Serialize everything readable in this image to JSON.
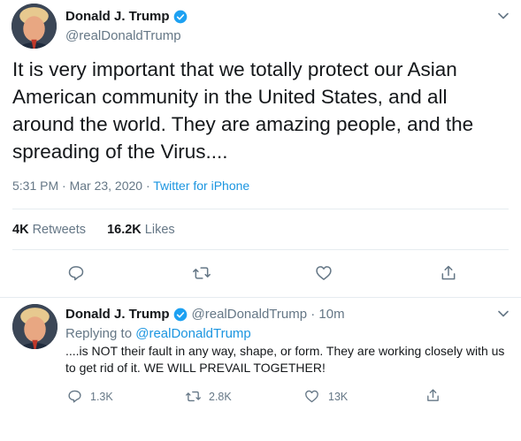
{
  "main_tweet": {
    "display_name": "Donald J. Trump",
    "handle": "@realDonaldTrump",
    "text": "It is very important that we totally protect our Asian American community in the United States, and all around the world. They are amazing people, and the spreading of the Virus....",
    "time": "5:31 PM · Mar 23, 2020 · ",
    "source": "Twitter for iPhone",
    "retweets_count": "4K",
    "retweets_label": "Retweets",
    "likes_count": "16.2K",
    "likes_label": "Likes"
  },
  "reply_tweet": {
    "display_name": "Donald J. Trump",
    "handle_time": "@realDonaldTrump · 10m",
    "replying_prefix": "Replying to ",
    "replying_mention": "@realDonaldTrump",
    "text": "....is NOT their fault in any way, shape, or form. They are working closely with us to get rid of it. WE WILL PREVAIL TOGETHER!",
    "reply_count": "1.3K",
    "retweet_count": "2.8K",
    "like_count": "13K"
  },
  "colors": {
    "text_primary": "#14171a",
    "text_secondary": "#657786",
    "link": "#1b95e0",
    "verified": "#1da1f2",
    "divider": "#e6ecf0"
  },
  "icons": [
    "verified-badge-icon",
    "chevron-down-icon",
    "reply-icon",
    "retweet-icon",
    "like-icon",
    "share-icon"
  ]
}
